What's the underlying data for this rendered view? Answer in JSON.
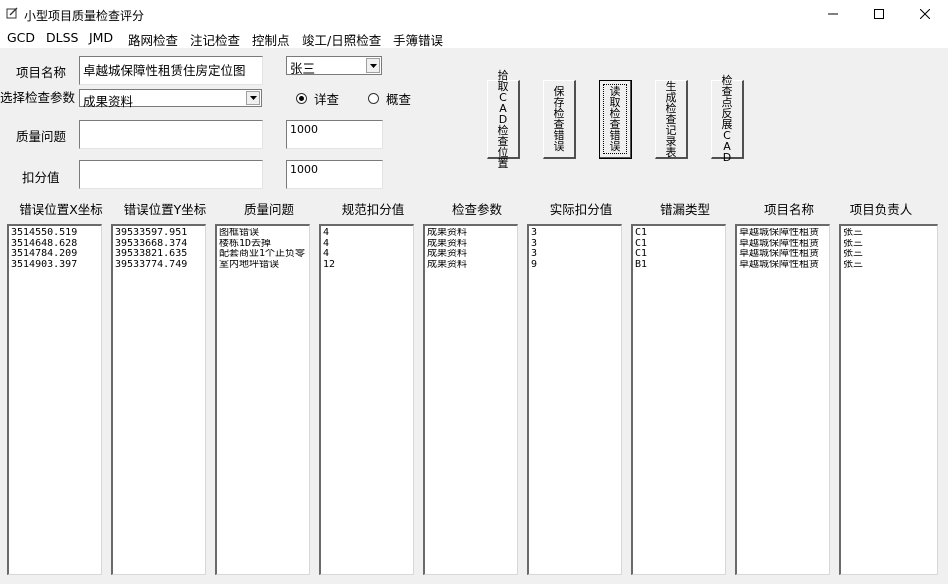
{
  "window": {
    "title": "小型项目质量检查评分"
  },
  "menu": [
    "GCD",
    "DLSS",
    "JMD",
    "路网检查",
    "注记检查",
    "控制点",
    "竣工/日照检查",
    "手簿错误"
  ],
  "form": {
    "project_name_label": "项目名称",
    "project_name_value": "卓越城保障性租赁住房定位图",
    "person_value": "张三",
    "param_label": "选择检查参数",
    "param_value": "成果资料",
    "radio_detail": "详查",
    "radio_summary": "概查",
    "issue_label": "质量问题",
    "issue_value": "",
    "issue_number": "1000",
    "deduction_label": "扣分值",
    "deduction_value": "",
    "deduction_number": "1000"
  },
  "buttons": {
    "pick_cad": "拾取CAD检查位置",
    "save_error": "保存检查错误",
    "read_error": "读取检查错误",
    "gen_record": "生成检查记录表",
    "show_cad": "检查点反展CAD"
  },
  "columns": [
    "错误位置X坐标",
    "错误位置Y坐标",
    "质量问题",
    "规范扣分值",
    "检查参数",
    "实际扣分值",
    "错漏类型",
    "项目名称",
    "项目负责人"
  ],
  "lists": [
    [
      "3514550.519",
      "3514648.628",
      "3514784.209",
      "3514903.397"
    ],
    [
      "39533597.951",
      "39533668.374",
      "39533821.635",
      "39533774.749"
    ],
    [
      "图框错误",
      "楼栋1D去掉",
      "配套商业1个正负零",
      "室内地坪错误"
    ],
    [
      "4",
      "4",
      "4",
      "12"
    ],
    [
      "成果资料",
      "成果资料",
      "成果资料",
      "成果资料"
    ],
    [
      "3",
      "3",
      "3",
      "9"
    ],
    [
      "C1",
      "C1",
      "C1",
      "B1"
    ],
    [
      "卓越城保障性租赁",
      "卓越城保障性租赁",
      "卓越城保障性租赁",
      "卓越城保障性租赁"
    ],
    [
      "张三",
      "张三",
      "张三",
      "张三"
    ]
  ]
}
